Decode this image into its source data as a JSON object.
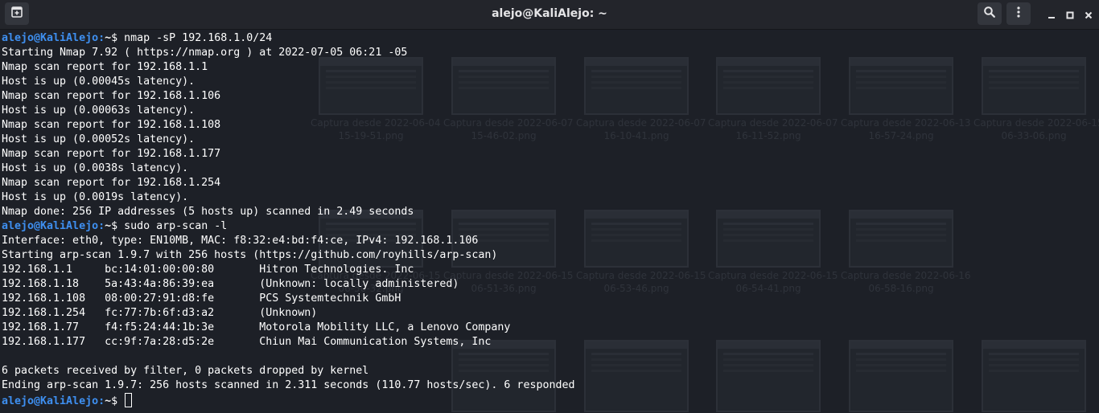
{
  "window": {
    "title": "alejo@KaliAlejo: ~"
  },
  "icons": {
    "new_tab": "new-tab-icon",
    "search": "search-icon",
    "menu": "kebab-menu-icon",
    "minimize": "minimize-icon",
    "maximize": "maximize-icon",
    "close": "close-icon"
  },
  "colors": {
    "prompt_user": "#3e8ff0",
    "terminal_bg": "#1d2027",
    "text": "#ffffff"
  },
  "prompt": {
    "user_host": "alejo@KaliAlejo",
    "path": "~",
    "symbol": "$ "
  },
  "terminal": {
    "lines": [
      {
        "prompt": true,
        "text": "nmap -sP 192.168.1.0/24"
      },
      {
        "text": "Starting Nmap 7.92 ( https://nmap.org ) at 2022-07-05 06:21 -05"
      },
      {
        "text": "Nmap scan report for 192.168.1.1"
      },
      {
        "text": "Host is up (0.00045s latency)."
      },
      {
        "text": "Nmap scan report for 192.168.1.106"
      },
      {
        "text": "Host is up (0.00063s latency)."
      },
      {
        "text": "Nmap scan report for 192.168.1.108"
      },
      {
        "text": "Host is up (0.00052s latency)."
      },
      {
        "text": "Nmap scan report for 192.168.1.177"
      },
      {
        "text": "Host is up (0.0038s latency)."
      },
      {
        "text": "Nmap scan report for 192.168.1.254"
      },
      {
        "text": "Host is up (0.0019s latency)."
      },
      {
        "text": "Nmap done: 256 IP addresses (5 hosts up) scanned in 2.49 seconds"
      },
      {
        "prompt": true,
        "text": "sudo arp-scan -l"
      },
      {
        "text": "Interface: eth0, type: EN10MB, MAC: f8:32:e4:bd:f4:ce, IPv4: 192.168.1.106"
      },
      {
        "text": "Starting arp-scan 1.9.7 with 256 hosts (https://github.com/royhills/arp-scan)"
      },
      {
        "text": "192.168.1.1     bc:14:01:00:00:80       Hitron Technologies. Inc"
      },
      {
        "text": "192.168.1.18    5a:43:4a:86:39:ea       (Unknown: locally administered)"
      },
      {
        "text": "192.168.1.108   08:00:27:91:d8:fe       PCS Systemtechnik GmbH"
      },
      {
        "text": "192.168.1.254   fc:77:7b:6f:d3:a2       (Unknown)"
      },
      {
        "text": "192.168.1.77    f4:f5:24:44:1b:3e       Motorola Mobility LLC, a Lenovo Company"
      },
      {
        "text": "192.168.1.177   cc:9f:7a:28:d5:2e       Chiun Mai Communication Systems, Inc"
      },
      {
        "text": ""
      },
      {
        "text": "6 packets received by filter, 0 packets dropped by kernel"
      },
      {
        "text": "Ending arp-scan 1.9.7: 256 hosts scanned in 2.311 seconds (110.77 hosts/sec). 6 responded"
      },
      {
        "prompt": true,
        "text": "",
        "cursor": true
      }
    ]
  },
  "desktop_files": [
    {
      "name": "Captura desde 2022-06-04 15-19-51.png"
    },
    {
      "name": "Captura desde 2022-06-07 15-46-02.png"
    },
    {
      "name": "Captura desde 2022-06-07 16-10-41.png"
    },
    {
      "name": "Captura desde 2022-06-07 16-11-52.png"
    },
    {
      "name": "Captura desde 2022-06-13 16-57-24.png"
    },
    {
      "name": "Captura desde 2022-06-15 06-33-06.png"
    },
    {
      "name": "Captura desde 2022-06-15 06-50-32.png"
    },
    {
      "name": "Captura desde 2022-06-15 06-51-36.png"
    },
    {
      "name": "Captura desde 2022-06-15 06-53-46.png"
    },
    {
      "name": "Captura desde 2022-06-15 06-54-41.png"
    },
    {
      "name": "Captura desde 2022-06-16 06-58-16.png"
    }
  ]
}
